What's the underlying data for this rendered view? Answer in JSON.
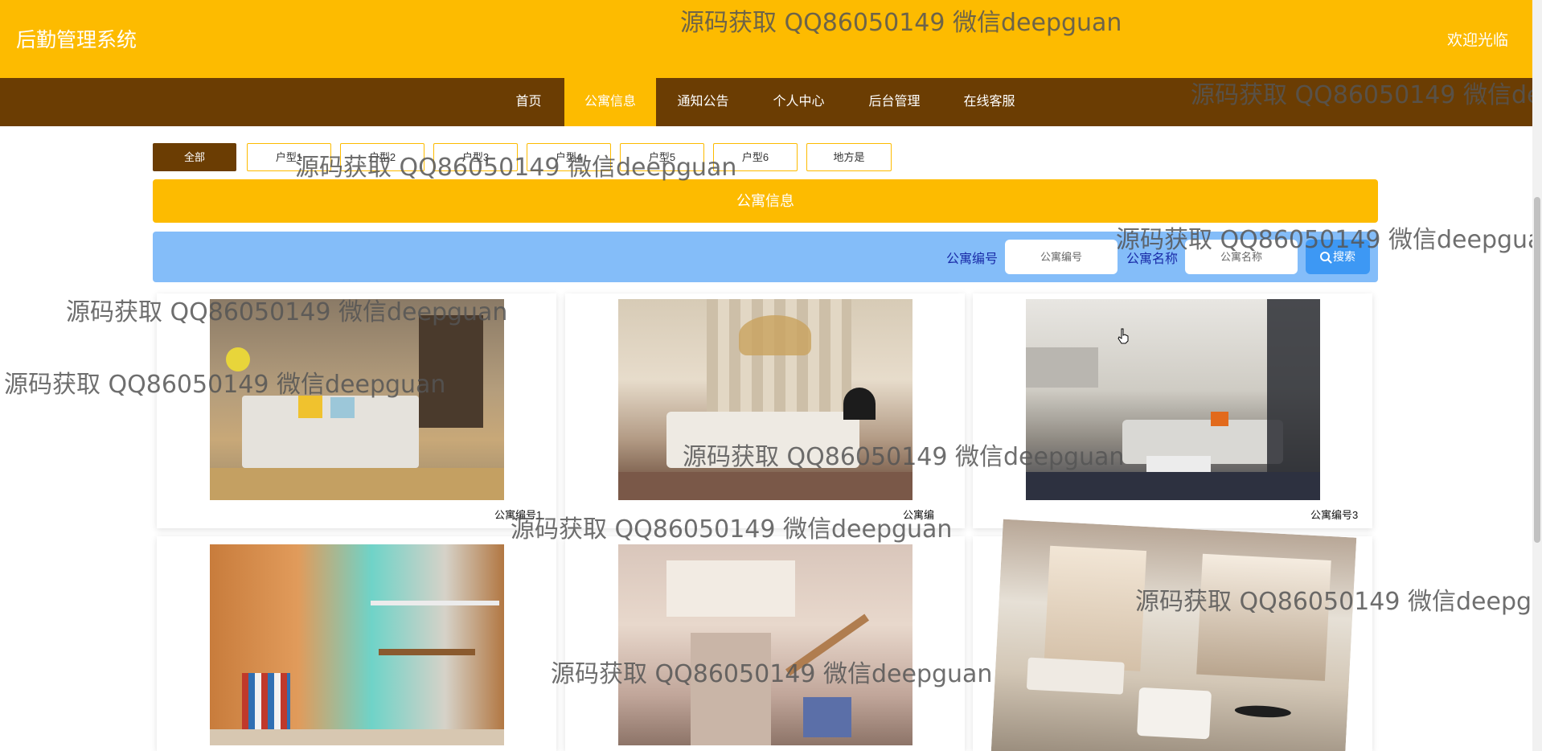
{
  "header": {
    "title": "后勤管理系统",
    "welcome": "欢迎光临"
  },
  "nav": {
    "items": [
      {
        "label": "首页",
        "active": false
      },
      {
        "label": "公寓信息",
        "active": true
      },
      {
        "label": "通知公告",
        "active": false
      },
      {
        "label": "个人中心",
        "active": false
      },
      {
        "label": "后台管理",
        "active": false
      },
      {
        "label": "在线客服",
        "active": false
      }
    ]
  },
  "filters": {
    "items": [
      {
        "label": "全部",
        "active": true
      },
      {
        "label": "户型1",
        "active": false
      },
      {
        "label": "户型2",
        "active": false
      },
      {
        "label": "户型3",
        "active": false
      },
      {
        "label": "户型4",
        "active": false
      },
      {
        "label": "户型5",
        "active": false
      },
      {
        "label": "户型6",
        "active": false
      },
      {
        "label": "地方是",
        "active": false
      }
    ]
  },
  "section": {
    "title": "公寓信息"
  },
  "search": {
    "code_label": "公寓编号",
    "code_placeholder": "公寓编号",
    "name_label": "公寓名称",
    "name_placeholder": "公寓名称",
    "button_label": "搜索"
  },
  "cards": [
    {
      "caption": "公寓编号1"
    },
    {
      "caption": "公寓编"
    },
    {
      "caption": "公寓编号3"
    },
    {
      "caption": ""
    },
    {
      "caption": ""
    },
    {
      "caption": ""
    }
  ],
  "watermark": {
    "text": "源码获取 QQ86050149 微信deepguan"
  },
  "colors": {
    "header_bg": "#fdbb00",
    "nav_bg": "#6b3d03",
    "search_bg": "#84bdf9",
    "search_btn": "#3d98f4"
  }
}
